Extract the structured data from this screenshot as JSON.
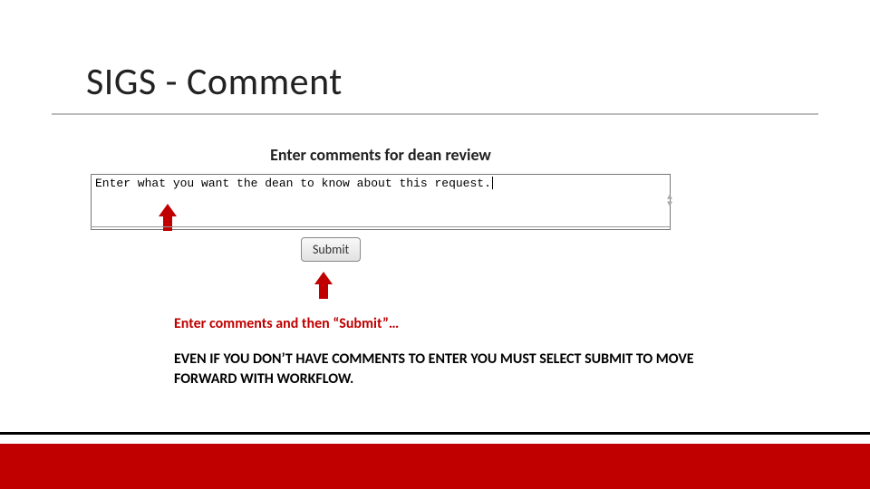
{
  "title": "SIGS - Comment",
  "screenshot": {
    "heading": "Enter comments for dean review",
    "comment_value": "Enter what you want the dean to know about this request.",
    "submit_label": "Submit"
  },
  "caption_red": "Enter comments and then “Submit”…",
  "caption_black": "EVEN IF YOU DON’T HAVE COMMENTS TO ENTER YOU MUST SELECT SUBMIT TO MOVE FORWARD WITH WORKFLOW."
}
